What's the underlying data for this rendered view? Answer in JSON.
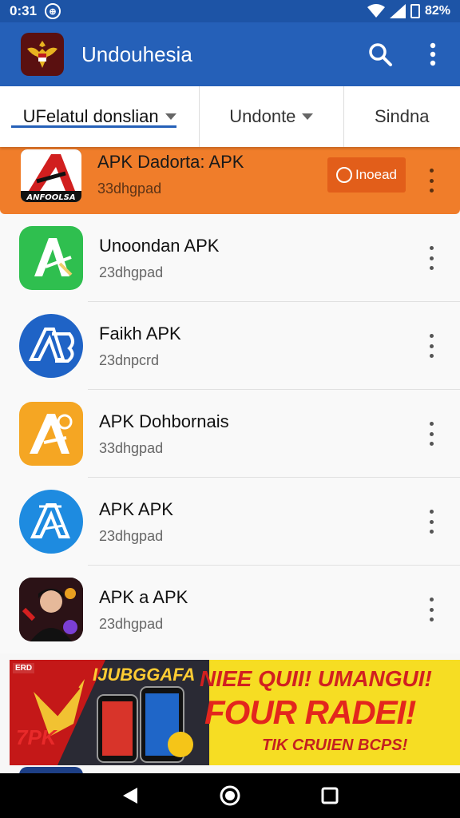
{
  "status_bar": {
    "time": "0:31",
    "battery": "82%"
  },
  "app_bar": {
    "title": "Undouhesia",
    "logo_icon": "garuda-emblem-icon",
    "search_icon": "search-icon",
    "menu_icon": "more-vert-icon"
  },
  "tabs": [
    {
      "label": "UFelatul donslian",
      "active": true,
      "has_dropdown": true
    },
    {
      "label": "Undonte",
      "active": false,
      "has_dropdown": true
    },
    {
      "label": "Sindna",
      "active": false,
      "has_dropdown": false
    }
  ],
  "featured": {
    "name": "APK Dadorta: APK",
    "sub": "33dhgpad",
    "install_label": "Inoead",
    "icon_text": "ANFOOLSA",
    "color": "#f07d2a"
  },
  "apps": [
    {
      "name": "Unoondan APK",
      "sub": "23dhgpad",
      "icon": "green-a-icon"
    },
    {
      "name": "Faikh APK",
      "sub": "23dnpcrd",
      "icon": "blue-a-icon"
    },
    {
      "name": "APK Dohbornais",
      "sub": "33dhgpad",
      "icon": "orange-a-icon"
    },
    {
      "name": "APK APK",
      "sub": "23dhgpad",
      "icon": "blue-circle-a-icon"
    },
    {
      "name": "APK a APK",
      "sub": "23dhgpad",
      "icon": "person-icon"
    }
  ],
  "banner": {
    "badge": "ERD",
    "brand": "IJUBGGAFA",
    "logo": "7PK",
    "headline1": "NIEE QUII! UMANGUI!",
    "headline2": "FOUR RADEI!",
    "headline3": "TIK CRUIEN BCPS!"
  },
  "nav": {
    "back_icon": "back-triangle-icon",
    "home_icon": "home-circle-icon",
    "recents_icon": "recents-square-icon"
  }
}
